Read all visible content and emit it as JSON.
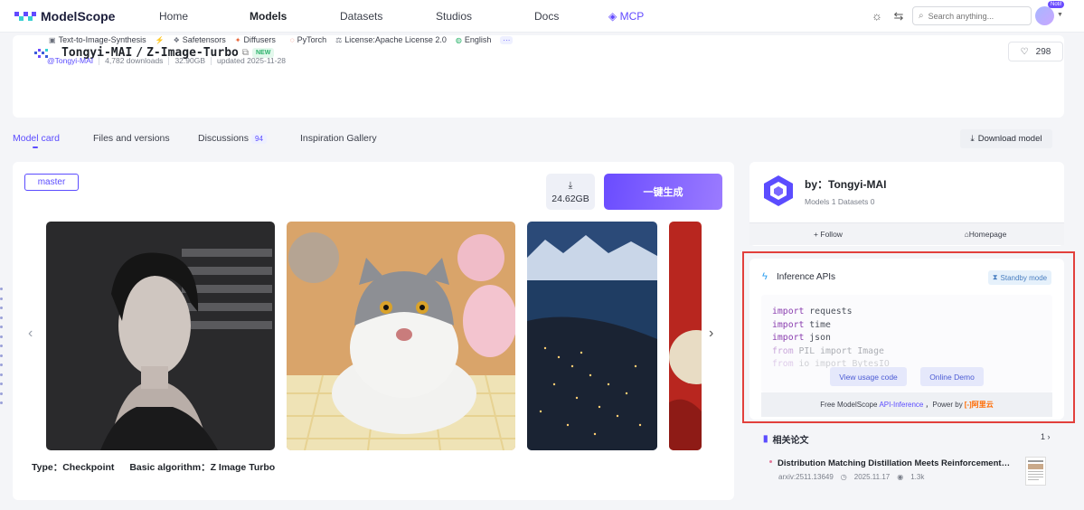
{
  "nav": {
    "brand": "ModelScope",
    "links": [
      "Home",
      "Models",
      "Datasets",
      "Studios",
      "Docs"
    ],
    "mcp": "MCP",
    "search_placeholder": "Search anything...",
    "noti_badge": "Noti!"
  },
  "model": {
    "owner": "Tongyi-MAI",
    "sep": "/",
    "name": "Z-Image-Turbo",
    "new_badge": "NEW",
    "likes": "298",
    "tags": [
      "Text-to-Image-Synthesis",
      "Safetensors",
      "Diffusers",
      "PyTorch",
      "License:Apache License 2.0",
      "English"
    ],
    "more": "···",
    "meta": {
      "owner_link": "@Tongyi-MAI",
      "downloads": "4,782 downloads",
      "size": "32.90GB",
      "updated": "updated 2025-11-28"
    }
  },
  "tabs": {
    "model_card": "Model card",
    "files": "Files and versions",
    "discussions": "Discussions",
    "discussions_count": "94",
    "gallery": "Inspiration Gallery",
    "download": "Download model"
  },
  "main": {
    "branch": "master",
    "download_size": "24.62GB",
    "generate": "一键生成",
    "caption_type": "Type：Checkpoint",
    "caption_algo": "Basic algorithm：Z Image Turbo"
  },
  "author": {
    "by": "by：Tongyi-MAI",
    "stats": "Models 1 Datasets 0",
    "follow": "+ Follow",
    "homepage": "Homepage"
  },
  "api": {
    "title": "Inference APIs",
    "standby": "Standby mode",
    "code_lines": [
      {
        "kw": "import",
        "rest": " requests"
      },
      {
        "kw": "import",
        "rest": " time"
      },
      {
        "kw": "import",
        "rest": " json"
      },
      {
        "kw": "from",
        "rest": " PIL import Image"
      },
      {
        "kw": "from",
        "rest": " io import BytesIO"
      }
    ],
    "view_code": "View usage code",
    "online_demo": "Online Demo",
    "foot_prefix": "Free ModelScope",
    "foot_link": "API-Inference",
    "foot_suffix": "，Power by",
    "foot_brand": "阿里云"
  },
  "papers": {
    "title": "相关论文",
    "page": "1",
    "item": {
      "title": "Distribution Matching Distillation Meets Reinforcement Lear...",
      "arxiv": "arxiv:2511.13649",
      "date": "2025.11.17",
      "views": "1.3k"
    }
  },
  "colors": {
    "accent": "#5b4cff",
    "highlight_box": "#e2403c"
  }
}
